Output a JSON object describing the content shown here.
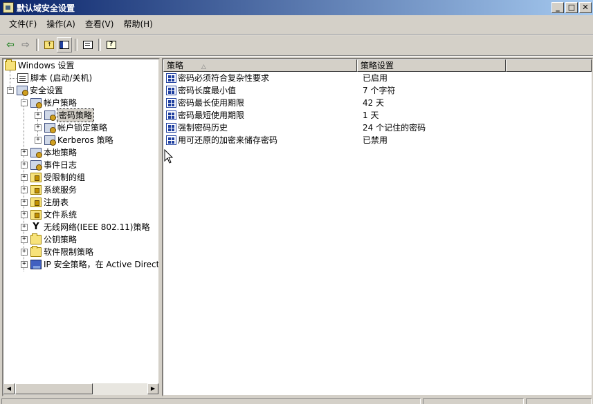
{
  "window": {
    "title": "默认域安全设置"
  },
  "menu": [
    "文件(F)",
    "操作(A)",
    "查看(V)",
    "帮助(H)"
  ],
  "toolbar": {
    "icons": [
      "back-arrow-icon",
      "forward-arrow-icon",
      "up-folder-icon",
      "show-hide-tree-icon",
      "export-list-icon",
      "help-icon"
    ]
  },
  "tree": {
    "root": "Windows 设置",
    "script": "脚本 (启动/关机)",
    "security": "安全设置",
    "account_policy": "帐户策略",
    "password_policy": "密码策略",
    "lockout_policy": "帐户锁定策略",
    "kerberos_policy": "Kerberos 策略",
    "local_policy": "本地策略",
    "event_log": "事件日志",
    "restricted_groups": "受限制的组",
    "system_services": "系统服务",
    "registry": "注册表",
    "file_system": "文件系统",
    "wireless": "无线网络(IEEE 802.11)策略",
    "public_key": "公钥策略",
    "software_restriction": "软件限制策略",
    "ip_security": "IP 安全策略，在 Active Directory"
  },
  "list": {
    "columns": {
      "policy": "策略",
      "setting": "策略设置"
    },
    "rows": [
      {
        "policy": "密码必须符合复杂性要求",
        "setting": "已启用"
      },
      {
        "policy": "密码长度最小值",
        "setting": "7 个字符"
      },
      {
        "policy": "密码最长使用期限",
        "setting": "42 天"
      },
      {
        "policy": "密码最短使用期限",
        "setting": "1 天"
      },
      {
        "policy": "强制密码历史",
        "setting": "24 个记住的密码"
      },
      {
        "policy": "用可还原的加密来储存密码",
        "setting": "已禁用"
      }
    ]
  },
  "colors": {
    "title_start": "#0a246a",
    "title_end": "#a6caf0",
    "chrome": "#d4d0c8"
  }
}
